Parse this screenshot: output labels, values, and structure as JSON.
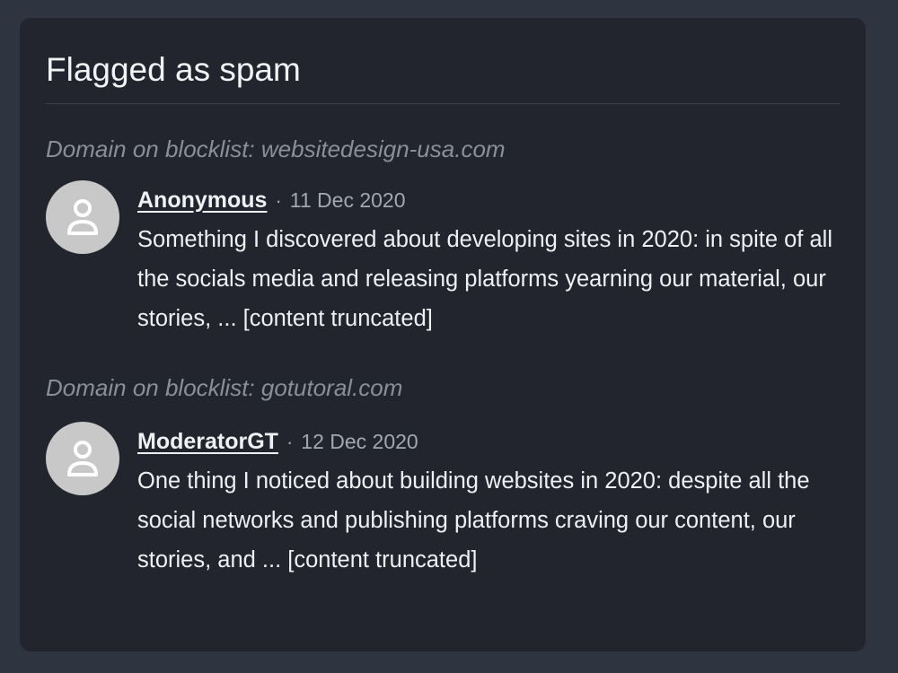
{
  "panel": {
    "title": "Flagged as spam"
  },
  "flags": [
    {
      "reason": "Domain on blocklist: websitedesign-usa.com",
      "author": "Anonymous",
      "separator": "·",
      "date": "11 Dec 2020",
      "body": "Something I discovered about developing sites in 2020: in spite of all the socials media and releasing platforms yearning our material, our stories, ... [content truncated]",
      "avatar_icon": "user-icon"
    },
    {
      "reason": "Domain on blocklist: gotutoral.com",
      "author": "ModeratorGT",
      "separator": "·",
      "date": "12 Dec 2020",
      "body": "One thing I noticed about building websites in 2020: despite all the social networks and publishing platforms craving our content, our stories, and ... [content truncated]",
      "avatar_icon": "user-icon"
    }
  ],
  "colors": {
    "page_background": "#2e3440",
    "card_background": "#22252d",
    "avatar_background": "#c8c8c8",
    "reason_text": "#8a8f98"
  }
}
